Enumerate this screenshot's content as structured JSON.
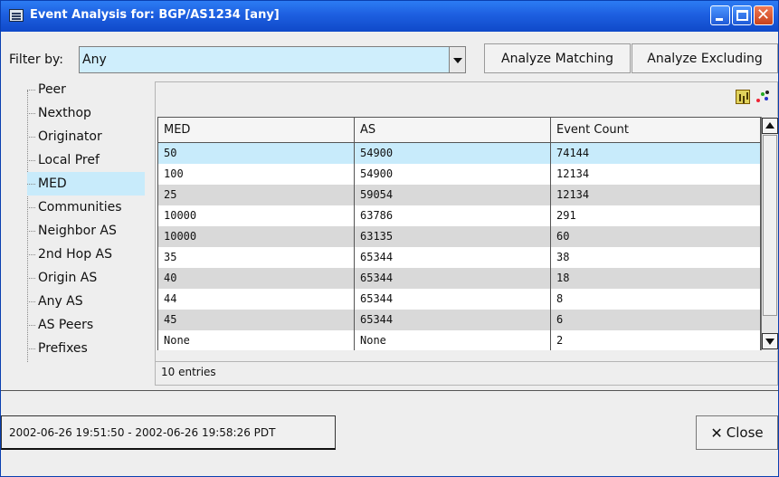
{
  "window": {
    "title": "Event Analysis for: BGP/AS1234 [any]"
  },
  "filter": {
    "label": "Filter by:",
    "value": "Any"
  },
  "buttons": {
    "analyze_matching": "Analyze Matching",
    "analyze_excluding": "Analyze Excluding",
    "time_range": "2002-06-26 19:51:50 - 2002-06-26 19:58:26 PDT",
    "close": "Close"
  },
  "tree": {
    "items": [
      "Peer",
      "Nexthop",
      "Originator",
      "Local Pref",
      "MED",
      "Communities",
      "Neighbor AS",
      "2nd Hop AS",
      "Origin AS",
      "Any AS",
      "AS Peers",
      "Prefixes"
    ],
    "selected": "MED"
  },
  "table": {
    "columns": [
      "MED",
      "AS",
      "Event Count"
    ],
    "rows": [
      [
        "50",
        "54900",
        "74144"
      ],
      [
        "100",
        "54900",
        "12134"
      ],
      [
        "25",
        "59054",
        "12134"
      ],
      [
        "10000",
        "63786",
        "291"
      ],
      [
        "10000",
        "63135",
        "60"
      ],
      [
        "35",
        "65344",
        "38"
      ],
      [
        "40",
        "65344",
        "18"
      ],
      [
        "44",
        "65344",
        "8"
      ],
      [
        "45",
        "65344",
        "6"
      ],
      [
        "None",
        "None",
        "2"
      ]
    ],
    "selected_row": 0,
    "entries": "10 entries"
  },
  "icons": {
    "window_icon": "window-app-icon",
    "chart": "bar-chart-icon",
    "scatter": "scatter-plot-icon",
    "close": "close-x-icon"
  },
  "colors": {
    "title_bar": "#1d5fe0",
    "selection": "#c8ebfb",
    "alt_row": "#d9d9d9"
  }
}
